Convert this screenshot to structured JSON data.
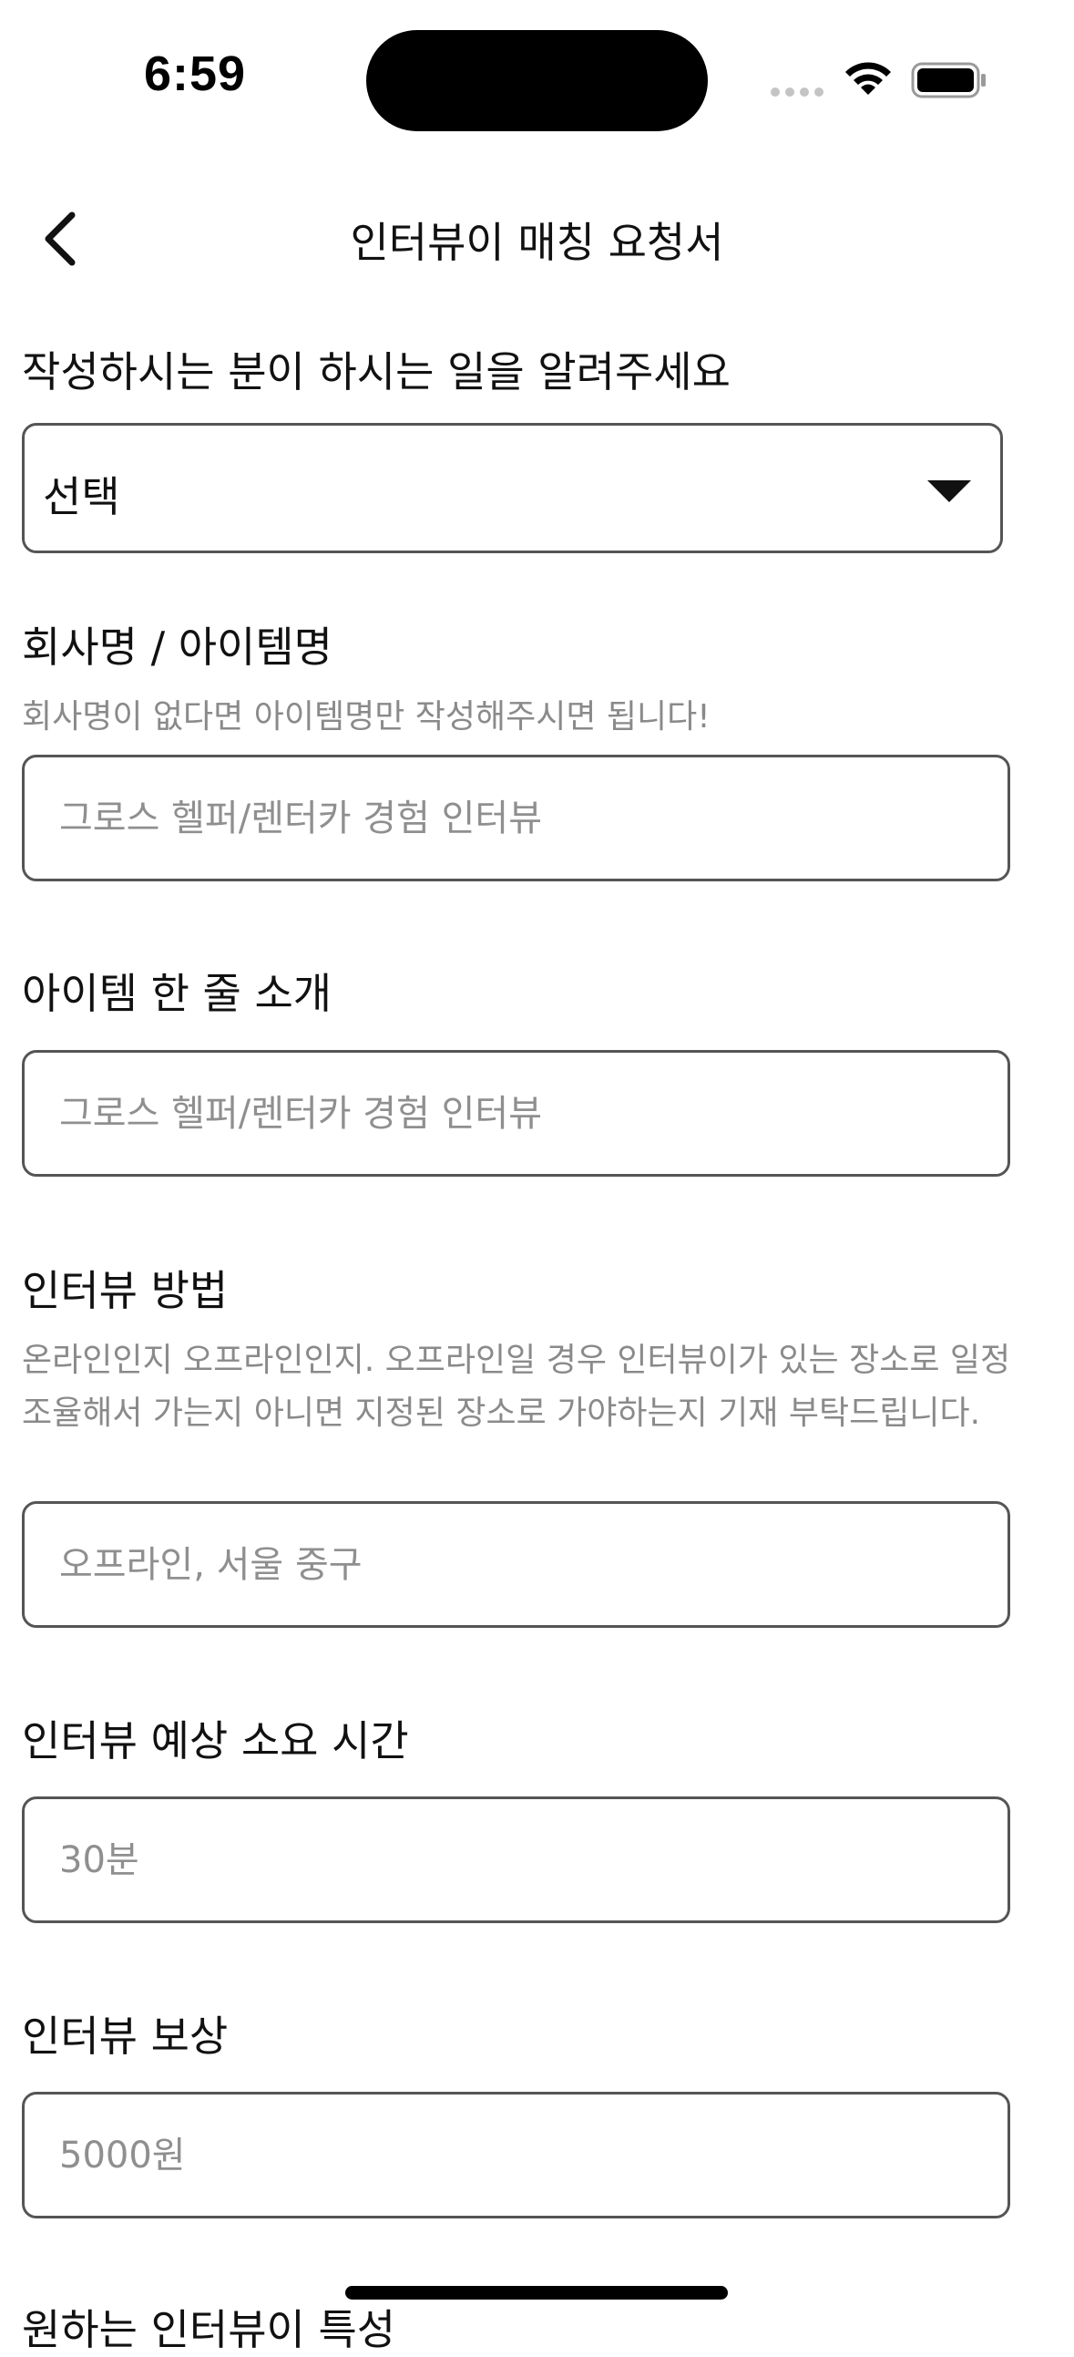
{
  "status_bar": {
    "time": "6:59"
  },
  "nav": {
    "title": "인터뷰이 매칭 요청서",
    "back_icon": "chevron-left-icon"
  },
  "form": {
    "role": {
      "label": "작성하시는 분이 하시는 일을 알려주세요",
      "selected": "선택"
    },
    "company": {
      "label": "회사명 / 아이템명",
      "hint": "회사명이 없다면 아이템명만 작성해주시면 됩니다!",
      "placeholder": "그로스 헬퍼/렌터카 경험 인터뷰",
      "value": ""
    },
    "intro": {
      "label": "아이템 한 줄 소개",
      "placeholder": "그로스 헬퍼/렌터카 경험 인터뷰",
      "value": ""
    },
    "method": {
      "label": "인터뷰 방법",
      "hint": "온라인인지 오프라인인지. 오프라인일 경우 인터뷰이가 있는 장소로 일정 조율해서 가는지 아니면 지정된 장소로 가야하는지 기재 부탁드립니다.",
      "placeholder": "오프라인, 서울 중구",
      "value": ""
    },
    "duration": {
      "label": "인터뷰 예상 소요 시간",
      "placeholder": "30분",
      "value": ""
    },
    "reward": {
      "label": "인터뷰 보상",
      "placeholder": "5000원",
      "value": ""
    },
    "traits": {
      "label": "원하는 인터뷰이 특성"
    }
  }
}
